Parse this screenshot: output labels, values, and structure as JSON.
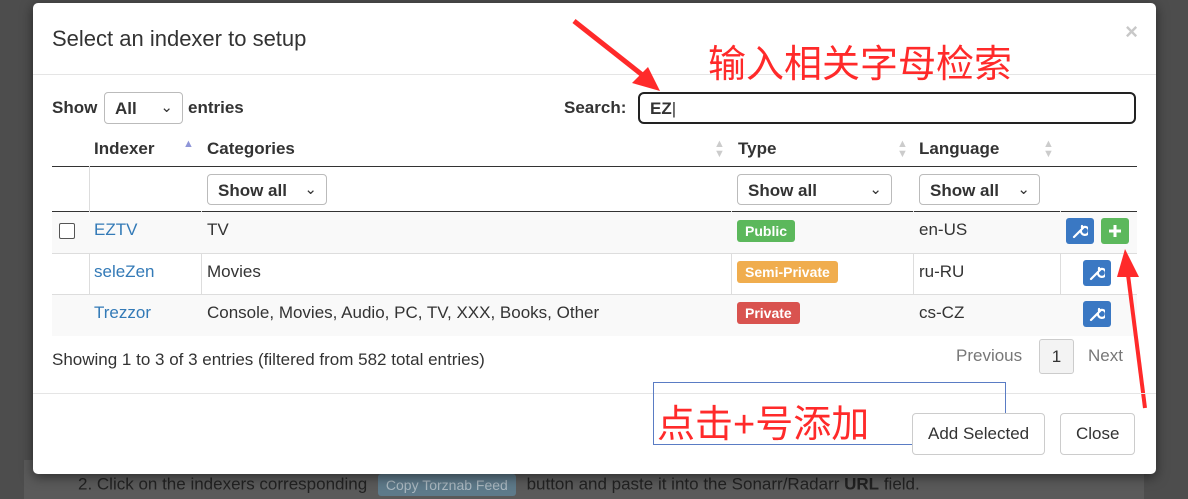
{
  "background": {
    "instruction_prefix": "2. Click on the indexers corresponding",
    "chip_label": "Copy Torznab Feed",
    "instruction_suffix_1": "button and paste it into the Sonarr/Radarr",
    "instruction_bold": "URL",
    "instruction_suffix_2": "field."
  },
  "modal": {
    "title": "Select an indexer to setup",
    "close_symbol": "×"
  },
  "annotations": {
    "search_hint": "输入相关字母检索",
    "add_hint": "点击+号添加",
    "color": "#ff2a2a"
  },
  "controls": {
    "show_label": "Show",
    "entries_select": "All",
    "entries_label": "entries",
    "search_label": "Search:",
    "search_value": "EZ"
  },
  "table": {
    "columns": [
      "Indexer",
      "Categories",
      "Type",
      "Language"
    ],
    "filters": {
      "categories": "Show all",
      "type": "Show all",
      "language": "Show all"
    },
    "rows": [
      {
        "indexer": "EZTV",
        "categories": "TV",
        "type": "Public",
        "type_color": "#5cb85c",
        "language": "en-US",
        "has_checkbox": true,
        "has_add": true
      },
      {
        "indexer": "seleZen",
        "categories": "Movies",
        "type": "Semi-Private",
        "type_color": "#f0ad4e",
        "language": "ru-RU",
        "has_checkbox": false,
        "has_add": false
      },
      {
        "indexer": "Trezzor",
        "categories": "Console, Movies, Audio, PC, TV, XXX, Books, Other",
        "type": "Private",
        "type_color": "#d9534f",
        "language": "cs-CZ",
        "has_checkbox": false,
        "has_add": false
      }
    ]
  },
  "pagination": {
    "info": "Showing 1 to 3 of 3 entries (filtered from 582 total entries)",
    "previous": "Previous",
    "page": "1",
    "next": "Next"
  },
  "footer": {
    "add_selected": "Add Selected",
    "close": "Close"
  },
  "icons": {
    "config": "wrench-icon",
    "add": "plus-icon",
    "sort_asc": "sort-asc-icon",
    "sort": "sort-icon",
    "chevron": "chevron-down-icon"
  }
}
